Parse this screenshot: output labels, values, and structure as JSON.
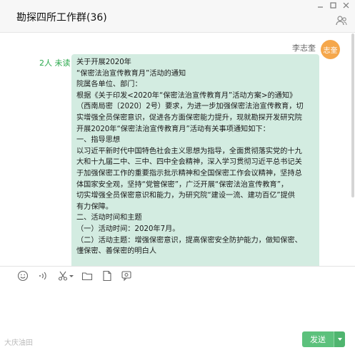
{
  "window": {
    "title": "勘探四所工作群(36)"
  },
  "message": {
    "sender": "李志奎",
    "avatar_text": "志奎",
    "read_status": "2人 未读",
    "lines": [
      "关于开展2020年",
      "“保密法治宣传教育月”活动的通知",
      "",
      "院属各单位、部门：",
      "根据《关于印发<2020年“保密法治宣传教育月”活动方案>的通知》",
      "（西南局密〔2020〕2号）要求，为进一步加强保密法治宣传教育，切",
      "实增强全员保密意识，促进各方面保密能力提升，现就勘探开发研究院",
      "开展2020年“保密法治宣传教育月”活动有关事项通知如下：",
      "一、指导思想",
      "以习近平新时代中国特色社会主义思想为指导，全面贯彻落实党的十九",
      "大和十九届二中、三中、四中全会精神，深入学习贯彻习近平总书记关",
      "于加强保密工作的重要指示批示精神和全国保密工作会议精神，坚持总",
      "体国家安全观，坚持“党管保密”，广泛开展“保密法治宣传教育”，",
      "切实增强全员保密意识和能力，为研究院“建设一流、建功百亿”提供",
      "有力保障。",
      "二、活动时间和主题",
      "（一）活动时间：2020年7月。",
      "（二）活动主题：增强保密意识，提高保密安全防护能力，做知保密、",
      "懂保密、善保密的明白人"
    ]
  },
  "toolbar": {
    "icons": [
      "emoji-icon",
      "voice-icon",
      "scissors-icon",
      "folder-icon",
      "file-icon",
      "chat-history-icon"
    ]
  },
  "footer": {
    "logo_text": "大庆油田",
    "send_label": "发送"
  }
}
